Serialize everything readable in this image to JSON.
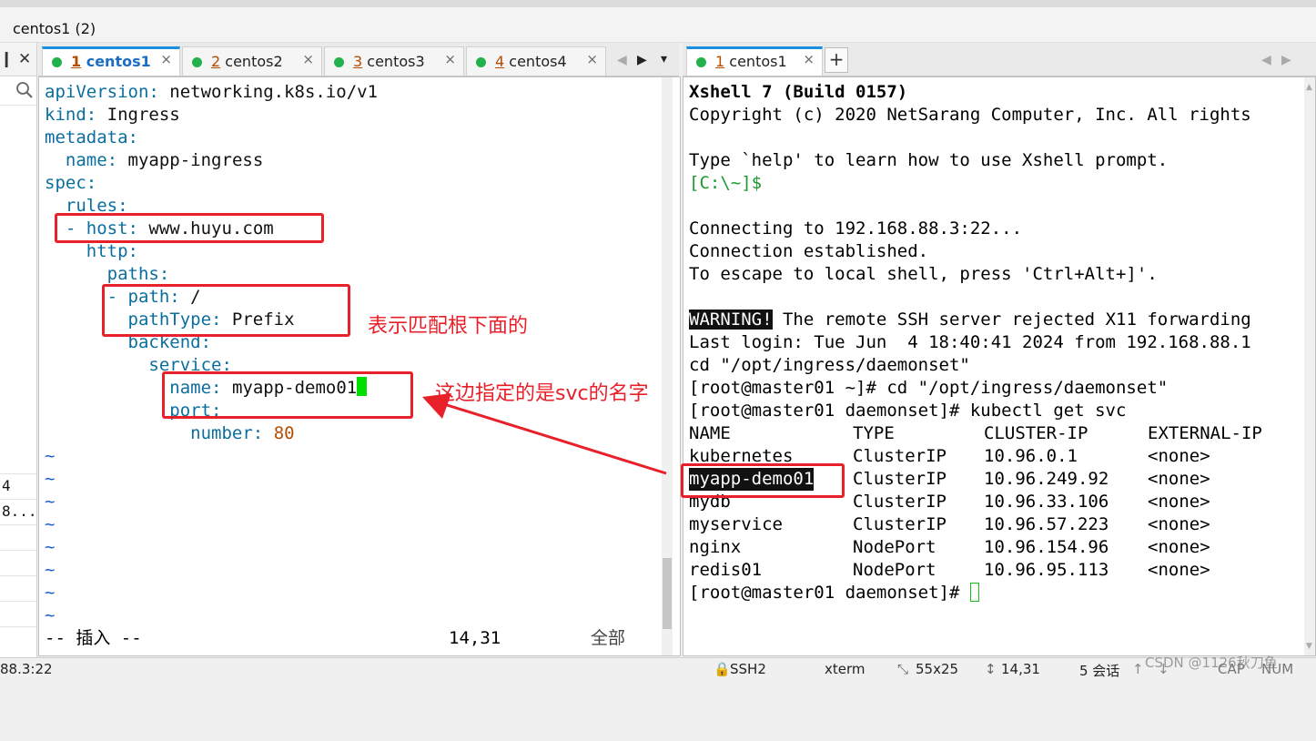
{
  "window": {
    "title": "centos1 (2)"
  },
  "left_panel": {
    "pin_glyph": "❙",
    "close_glyph": "✕",
    "search_icon": "search-icon",
    "items": [
      "4",
      "8...."
    ]
  },
  "left_tabs": [
    {
      "num": "1",
      "name": "centos1",
      "active": true
    },
    {
      "num": "2",
      "name": "centos2",
      "active": false
    },
    {
      "num": "3",
      "name": "centos3",
      "active": false
    },
    {
      "num": "4",
      "name": "centos4",
      "active": false
    }
  ],
  "right_tabs": [
    {
      "num": "1",
      "name": "centos1",
      "active": true
    }
  ],
  "tab_controls": {
    "close": "×",
    "prev": "◀",
    "next": "▶",
    "menu": "▾",
    "add": "+"
  },
  "editor": {
    "lines": [
      {
        "key": "apiVersion",
        "value": " networking.k8s.io/v1",
        "indent": ""
      },
      {
        "key": "kind",
        "value": " Ingress",
        "indent": ""
      },
      {
        "key": "metadata",
        "value": "",
        "indent": ""
      },
      {
        "key": "name",
        "value": " myapp-ingress",
        "indent": "  "
      },
      {
        "key": "spec",
        "value": "",
        "indent": ""
      },
      {
        "key": "rules",
        "value": "",
        "indent": "  "
      },
      {
        "key": "host",
        "value": " www.huyu.com",
        "indent": "  - "
      },
      {
        "key": "http",
        "value": "",
        "indent": "    "
      },
      {
        "key": "paths",
        "value": "",
        "indent": "      "
      },
      {
        "key": "path",
        "value": " /",
        "indent": "      - "
      },
      {
        "key": "pathType",
        "value": " Prefix",
        "indent": "        "
      },
      {
        "key": "backend",
        "value": "",
        "indent": "        "
      },
      {
        "key": "service",
        "value": "",
        "indent": "          "
      },
      {
        "key": "name",
        "value": " myapp-demo01",
        "indent": "            "
      },
      {
        "key": "port",
        "value": "",
        "indent": "            "
      },
      {
        "key": "number",
        "value": " 80",
        "indent": "              "
      }
    ],
    "tildes": [
      "~",
      "~",
      "~",
      "~",
      "~",
      "~",
      "~",
      "~"
    ],
    "mode": "-- 插入 --",
    "position": "14,31",
    "scroll": "全部"
  },
  "annotations": {
    "note1": "表示匹配根下面的",
    "note2": "这边指定的是svc的名字"
  },
  "terminal": {
    "lines": [
      "Xshell 7 (Build 0157)",
      "Copyright (c) 2020 NetSarang Computer, Inc. All rights",
      "",
      "Type `help' to learn how to use Xshell prompt.",
      "[C:\\~]$",
      "",
      "Connecting to 192.168.88.3:22...",
      "Connection established.",
      "To escape to local shell, press 'Ctrl+Alt+]'.",
      "",
      "WARNING!",
      " The remote SSH server rejected X11 forwarding",
      "Last login: Tue Jun  4 18:40:41 2024 from 192.168.88.1",
      "cd \"/opt/ingress/daemonset\"",
      "[root@master01 ~]# cd \"/opt/ingress/daemonset\"",
      "[root@master01 daemonset]# kubectl get svc"
    ],
    "table_header": [
      "NAME",
      "TYPE",
      "CLUSTER-IP",
      "EXTERNAL-IP"
    ],
    "table_rows": [
      [
        "kubernetes",
        "ClusterIP",
        "10.96.0.1",
        "<none>"
      ],
      [
        "myapp-demo01",
        "ClusterIP",
        "10.96.249.92",
        "<none>"
      ],
      [
        "mydb",
        "ClusterIP",
        "10.96.33.106",
        "<none>"
      ],
      [
        "myservice",
        "ClusterIP",
        "10.96.57.223",
        "<none>"
      ],
      [
        "nginx",
        "NodePort",
        "10.96.154.96",
        "<none>"
      ],
      [
        "redis01",
        "NodePort",
        "10.96.95.113",
        "<none>"
      ]
    ],
    "prompt": "[root@master01 daemonset]# "
  },
  "status": {
    "address": "88.3:22",
    "protocol": "SSH2",
    "term": "xterm",
    "size": "55x25",
    "cursor": "14,31",
    "sessions": "5 会话",
    "caps": "CAP",
    "num": "NUM",
    "watermark": "CSDN @1126秋刀鱼"
  },
  "colors": {
    "accent": "#1a8fe0",
    "annotation": "#e8202a",
    "yaml_key": "#0a6e9e",
    "prompt_green": "#1c9b2d",
    "cursor": "#00e000"
  }
}
